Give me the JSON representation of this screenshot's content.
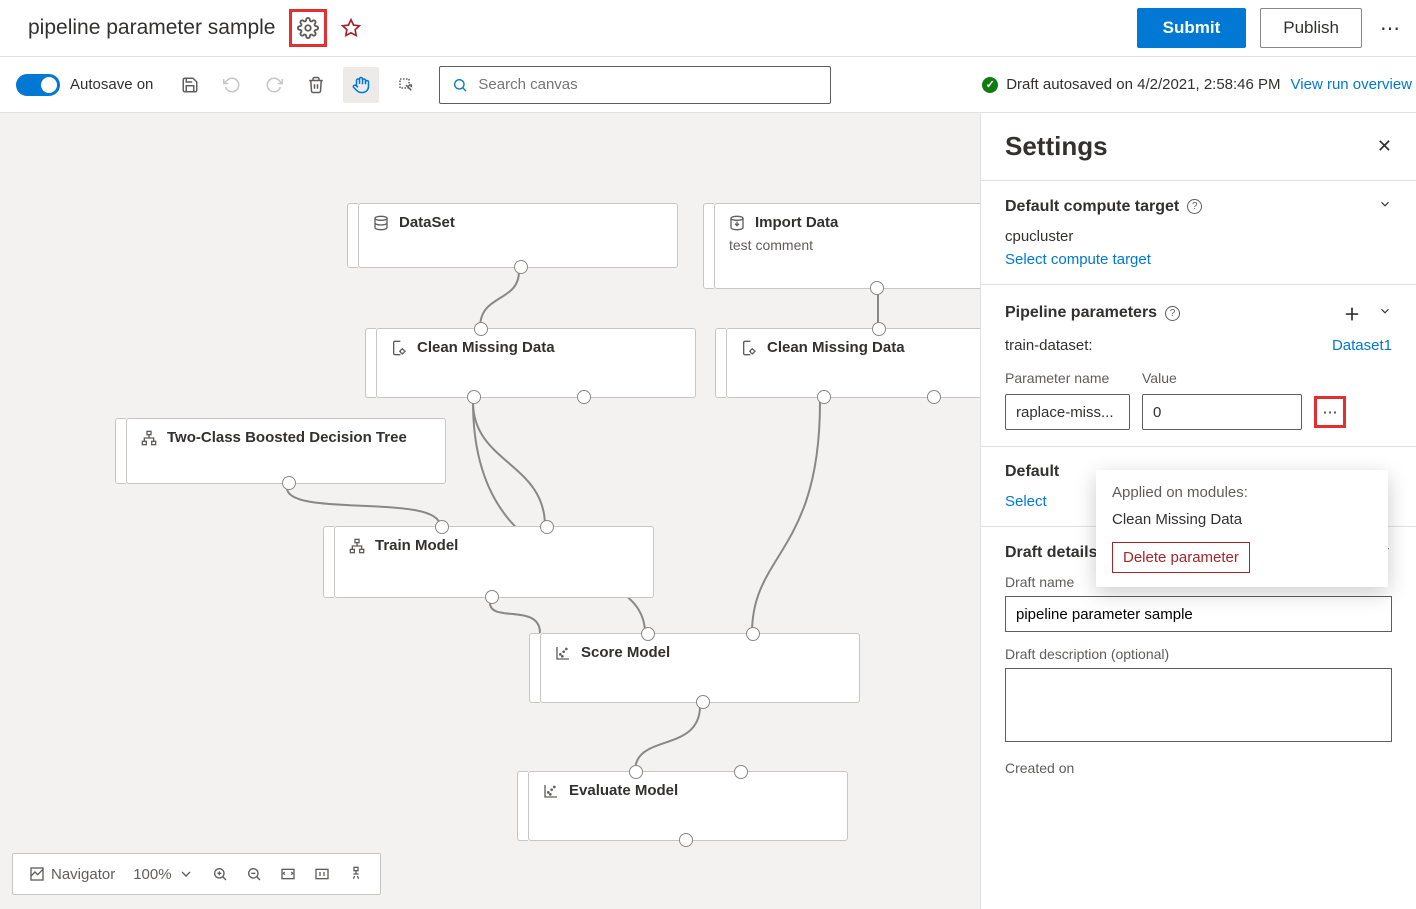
{
  "header": {
    "title": "pipeline parameter sample",
    "submit": "Submit",
    "publish": "Publish"
  },
  "toolbar": {
    "autosave_label": "Autosave on",
    "search_placeholder": "Search canvas",
    "draft_status": "Draft autosaved on 4/2/2021, 2:58:46 PM",
    "view_run": "View run overview"
  },
  "nodes": {
    "dataset": {
      "label": "DataSet"
    },
    "import_data": {
      "label": "Import Data",
      "subtitle": "test comment"
    },
    "clean1": {
      "label": "Clean Missing Data"
    },
    "clean2": {
      "label": "Clean Missing Data"
    },
    "twoclass": {
      "label": "Two-Class Boosted Decision Tree"
    },
    "train": {
      "label": "Train Model"
    },
    "score": {
      "label": "Score Model"
    },
    "evaluate": {
      "label": "Evaluate Model"
    }
  },
  "settings": {
    "title": "Settings",
    "compute": {
      "heading": "Default compute target",
      "value": "cpucluster",
      "select_link": "Select compute target"
    },
    "params": {
      "heading": "Pipeline parameters",
      "train_label": "train-dataset:",
      "train_value": "Dataset1",
      "name_label": "Parameter name",
      "value_label": "Value",
      "name_value": "raplace-miss...",
      "value_value": "0"
    },
    "datastore": {
      "heading_trunc": "Default",
      "select_trunc": "Select "
    },
    "draft": {
      "heading": "Draft details",
      "name_label": "Draft name",
      "name_value": "pipeline parameter sample",
      "desc_label": "Draft description (optional)",
      "created_label": "Created on"
    }
  },
  "popup": {
    "applied_label": "Applied on modules:",
    "module": "Clean Missing Data",
    "delete": "Delete parameter"
  },
  "bottom": {
    "navigator": "Navigator",
    "zoom": "100%"
  }
}
